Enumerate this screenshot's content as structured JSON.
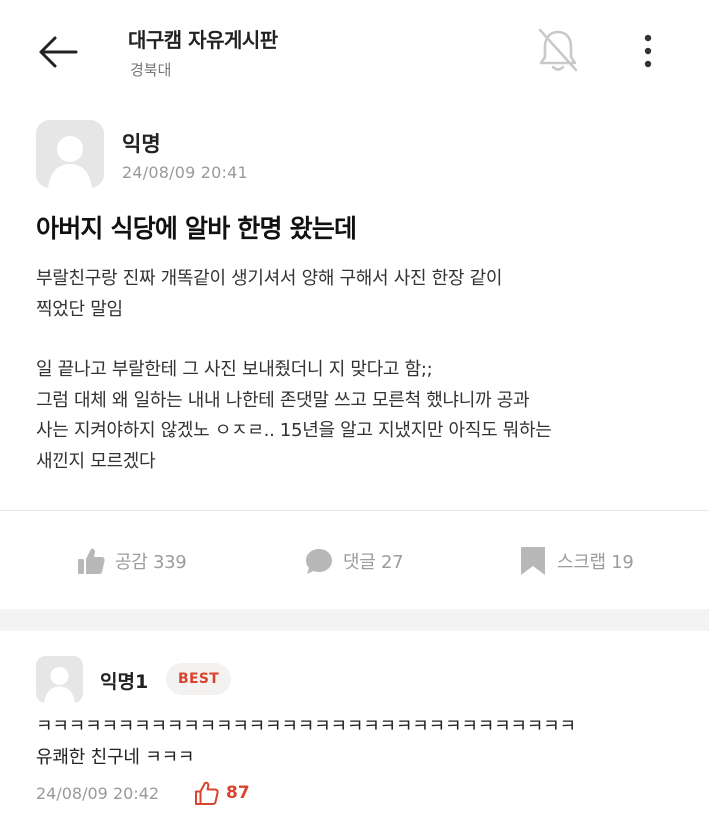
{
  "header": {
    "title": "대구캠 자유게시판",
    "subtitle": "경북대",
    "back_icon": "back-arrow-icon",
    "bell_icon": "bell-off-icon",
    "more_icon": "more-vertical-icon"
  },
  "post": {
    "author": "익명",
    "timestamp": "24/08/09 20:41",
    "title": "아버지 식당에 알바 한명 왔는데",
    "body_lines": [
      "부랄친구랑 진짜 개똑같이 생기셔서 양해 구해서 사진 한장 같이",
      "찍었단 말임",
      "",
      "일 끝나고 부랄한테 그 사진 보내줬더니 지 맞다고 함;;",
      "그럼 대체 왜 일하는 내내 나한테 존댓말 쓰고 모른척 했냐니까 공과",
      "사는 지켜야하지 않겠노 ㅇㅈㄹ.. 15년을 알고 지냈지만 아직도 뭐하는",
      "새낀지 모르겠다"
    ]
  },
  "actions": {
    "like": {
      "icon": "thumbs-up-icon",
      "label": "공감 339"
    },
    "comment": {
      "icon": "comment-bubble-icon",
      "label": "댓글 27"
    },
    "scrap": {
      "icon": "bookmark-icon",
      "label": "스크랩 19"
    }
  },
  "comment": {
    "author": "익명1",
    "badge": "BEST",
    "lines": [
      "ㅋㅋㅋㅋㅋㅋㅋㅋㅋㅋㅋㅋㅋㅋㅋㅋㅋㅋㅋㅋㅋㅋㅋㅋㅋㅋㅋㅋㅋㅋㅋㅋㅋ",
      "유쾌한 친구네 ㅋㅋㅋ"
    ],
    "timestamp": "24/08/09 20:42",
    "like_count": "87",
    "like_icon": "thumbs-up-outline-icon"
  },
  "colors": {
    "accent_red": "#d8452f",
    "muted_gray": "#9c9c9c",
    "separator": "#f3f3f3"
  }
}
